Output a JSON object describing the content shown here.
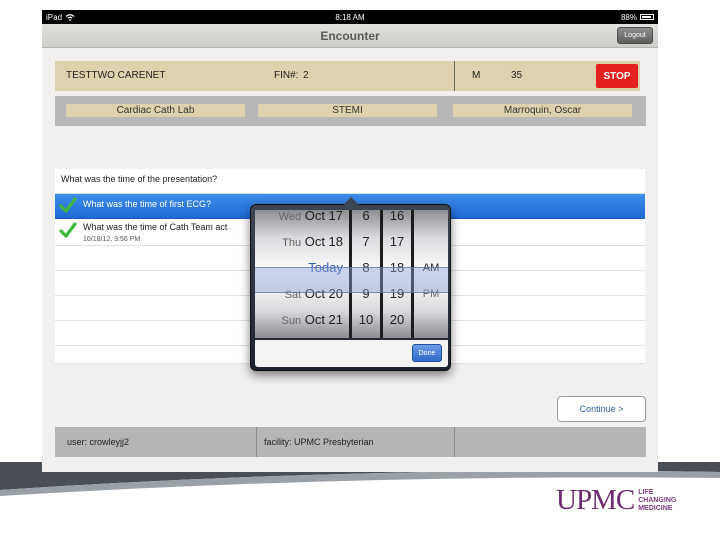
{
  "status_bar": {
    "carrier": "iPad",
    "time": "8:18 AM",
    "battery": "88%"
  },
  "nav": {
    "title": "Encounter",
    "logout_label": "Logout"
  },
  "patient": {
    "name": "TESTTWO CARENET",
    "fin_label": "FIN#:",
    "fin_value": "2",
    "sex": "M",
    "age": "35",
    "stop_label": "STOP"
  },
  "info": {
    "location": "Cardiac Cath Lab",
    "type": "STEMI",
    "physician": "Marroquin, Oscar"
  },
  "questions": [
    {
      "text": "What was the time of the presentation?",
      "sub": "",
      "checked": false,
      "selected": false
    },
    {
      "text": "What was the time of first ECG?",
      "sub": "",
      "checked": true,
      "selected": true
    },
    {
      "text": "What was the time of Cath Team act",
      "sub": "10/18/12, 3:56 PM",
      "checked": true,
      "selected": false
    }
  ],
  "picker": {
    "dates": [
      {
        "dow": "Wed",
        "day": "Oct 17"
      },
      {
        "dow": "Thu",
        "day": "Oct 18"
      },
      {
        "dow": "",
        "day": "Today"
      },
      {
        "dow": "Sat",
        "day": "Oct 20"
      },
      {
        "dow": "Sun",
        "day": "Oct 21"
      }
    ],
    "hours": [
      "6",
      "7",
      "8",
      "9",
      "10"
    ],
    "minutes": [
      "16",
      "17",
      "18",
      "19",
      "20"
    ],
    "ampm": [
      "",
      "",
      "AM",
      "PM",
      ""
    ],
    "selected_index": 2,
    "done_label": "Done"
  },
  "continue_label": "Continue  >",
  "footer": {
    "user": "user: crowleyjj2",
    "facility": "facility: UPMC Presbyterian"
  },
  "logo": {
    "word": "UPMC",
    "tag_line1": "LIFE",
    "tag_line2": "CHANGING",
    "tag_line3": "MEDICINE"
  },
  "colors": {
    "stop": "#e4211f",
    "selected_row": "#1f69d4",
    "tan": "#ddd1ae",
    "upmc_purple": "#6f2a73"
  }
}
